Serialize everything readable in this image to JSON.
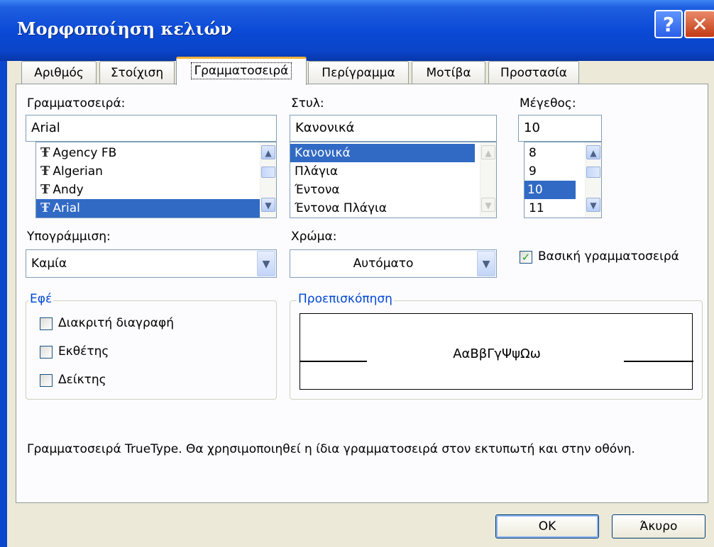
{
  "window": {
    "title": "Μορφοποίηση κελιών",
    "help_label": "?",
    "close_label": "✕"
  },
  "tabs": [
    "Αριθμός",
    "Στοίχιση",
    "Γραμματοσειρά",
    "Περίγραμμα",
    "Μοτίβα",
    "Προστασία"
  ],
  "font": {
    "label": "Γραμματοσειρά:",
    "value": "Arial",
    "items": [
      "Agency FB",
      "Algerian",
      "Andy",
      "Arial"
    ],
    "selected": "Arial",
    "icon": "truetype-icon"
  },
  "style": {
    "label": "Στυλ:",
    "value": "Κανονικά",
    "items": [
      "Κανονικά",
      "Πλάγια",
      "Έντονα",
      "Έντονα Πλάγια"
    ],
    "selected": "Κανονικά"
  },
  "size": {
    "label": "Μέγεθος:",
    "value": "10",
    "items": [
      "8",
      "9",
      "10",
      "11"
    ],
    "selected": "10"
  },
  "underline": {
    "label": "Υπογράμμιση:",
    "value": "Καμία"
  },
  "color": {
    "label": "Χρώμα:",
    "value": "Αυτόματο"
  },
  "normal_font": {
    "label": "Βασική γραμματοσειρά",
    "checked": true
  },
  "effects": {
    "label": "Εφέ",
    "options": [
      {
        "label": "Διακριτή διαγραφή",
        "checked": false
      },
      {
        "label": "Εκθέτης",
        "checked": false
      },
      {
        "label": "Δείκτης",
        "checked": false
      }
    ]
  },
  "preview": {
    "label": "Προεπισκόπηση",
    "sample": "ΑαΒβΓγΨψΩω"
  },
  "description": "Γραμματοσειρά TrueType.  Θα χρησιμοποιηθεί η ίδια γραμματοσειρά στον εκτυπωτή και στην οθόνη.",
  "buttons": {
    "ok": "OK",
    "cancel": "Άκυρο"
  },
  "colors": {
    "titlebar": "#0b4ad6",
    "selection": "#316ac5",
    "group_label": "#0046d5",
    "active_tab_accent": "#f6b23b"
  }
}
